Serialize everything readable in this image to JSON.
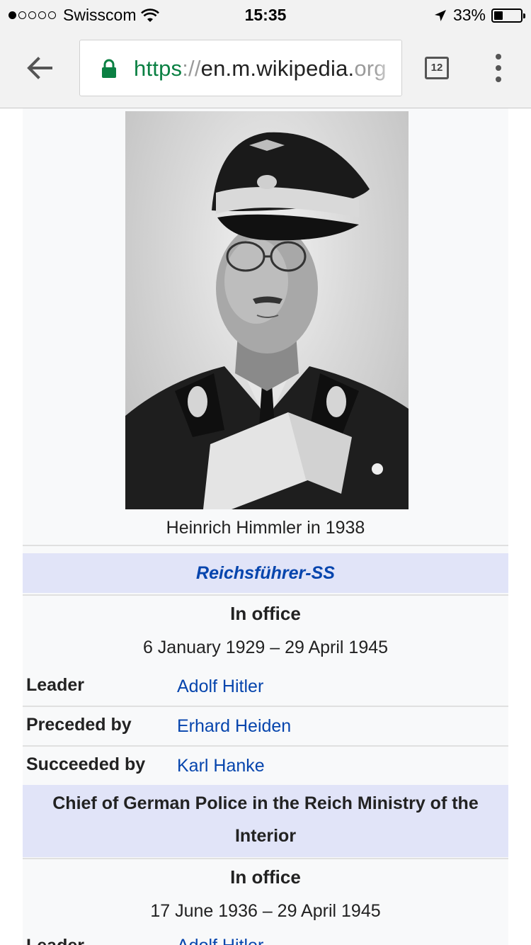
{
  "status_bar": {
    "carrier": "Swisscom",
    "signal_bars_filled": 1,
    "signal_bars_total": 5,
    "time": "15:35",
    "battery_percent": "33%",
    "battery_level": 0.33
  },
  "browser": {
    "url_scheme": "https",
    "url_sep": "://",
    "url_host": "en.m.wikipedia.",
    "url_rest": "org",
    "tab_count": "12"
  },
  "infobox": {
    "image_caption": "Heinrich Himmler in 1938",
    "sections": [
      {
        "title": "Reichsführer-SS",
        "in_office_label": "In office",
        "term": "6 January 1929 – 29 April 1945",
        "rows": [
          {
            "label": "Leader",
            "value": "Adolf Hitler"
          },
          {
            "label": "Preceded by",
            "value": "Erhard Heiden"
          },
          {
            "label": "Succeeded by",
            "value": "Karl Hanke"
          }
        ]
      },
      {
        "title_line1": "Chief of German Police in the Reich Ministry of the",
        "title_line2": "Interior",
        "in_office_label": "In office",
        "term": "17 June 1936 – 29 April 1945",
        "rows": [
          {
            "label": "Leader",
            "value": "Adolf Hitler"
          }
        ]
      }
    ]
  }
}
